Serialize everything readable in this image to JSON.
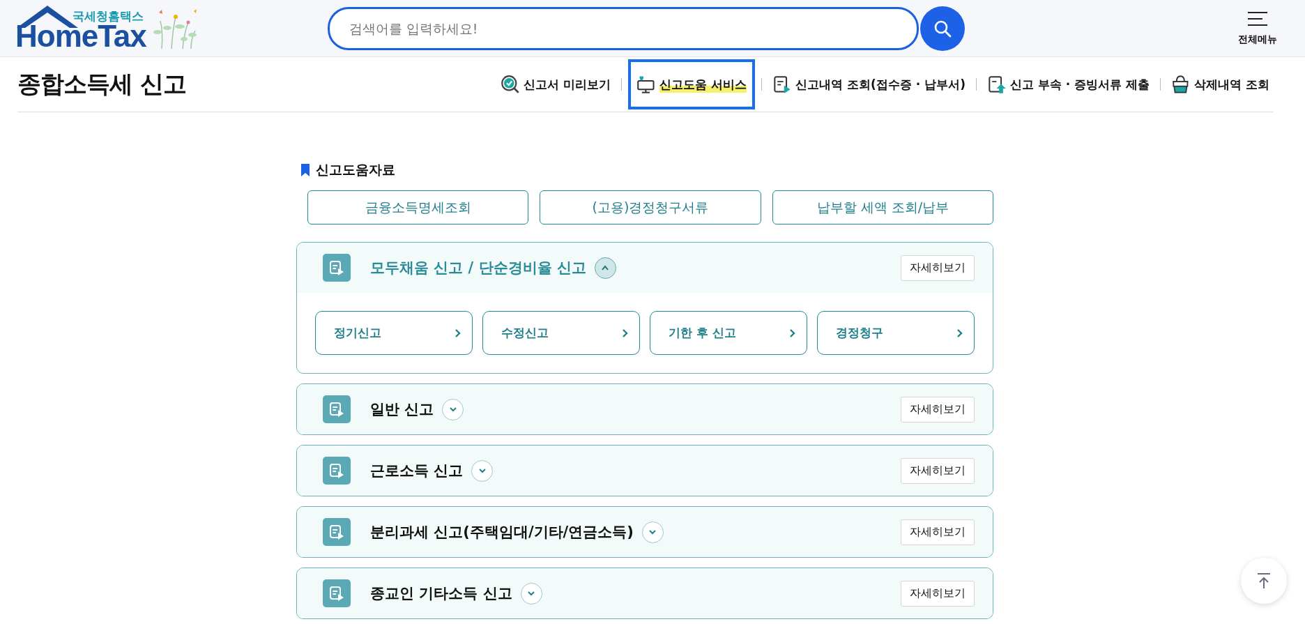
{
  "header": {
    "logo_subtitle": "국세청홈택스",
    "logo_text": "HomeTax",
    "search": {
      "placeholder": "검색어를 입력하세요!"
    },
    "menu_label": "전체메뉴"
  },
  "page_title": "종합소득세 신고",
  "links": [
    {
      "label": "신고서 미리보기",
      "kind": "preview",
      "selected": false
    },
    {
      "label": "신고도움 서비스",
      "kind": "help",
      "selected": true
    },
    {
      "label": "신고내역 조회(접수증 · 납부서)",
      "kind": "history",
      "selected": false
    },
    {
      "label": "신고 부속 · 증빙서류 제출",
      "kind": "upload",
      "selected": false
    },
    {
      "label": "삭제내역 조회",
      "kind": "deleted",
      "selected": false
    }
  ],
  "section_title": "신고도움자료",
  "resource_buttons": [
    "금융소득명세조회",
    "(고용)경정청구서류",
    "납부할 세액 조회/납부"
  ],
  "accordions": [
    {
      "title": "모두채움 신고 / 단순경비율 신고",
      "expanded": true,
      "detail_label": "자세히보기",
      "sub_buttons": [
        "정기신고",
        "수정신고",
        "기한 후 신고",
        "경정청구"
      ]
    },
    {
      "title": "일반 신고",
      "expanded": false,
      "detail_label": "자세히보기"
    },
    {
      "title": "근로소득 신고",
      "expanded": false,
      "detail_label": "자세히보기"
    },
    {
      "title": "분리과세 신고(주택임대/기타/연금소득)",
      "expanded": false,
      "detail_label": "자세히보기"
    },
    {
      "title": "종교인 기타소득 신고",
      "expanded": false,
      "detail_label": "자세히보기"
    }
  ]
}
